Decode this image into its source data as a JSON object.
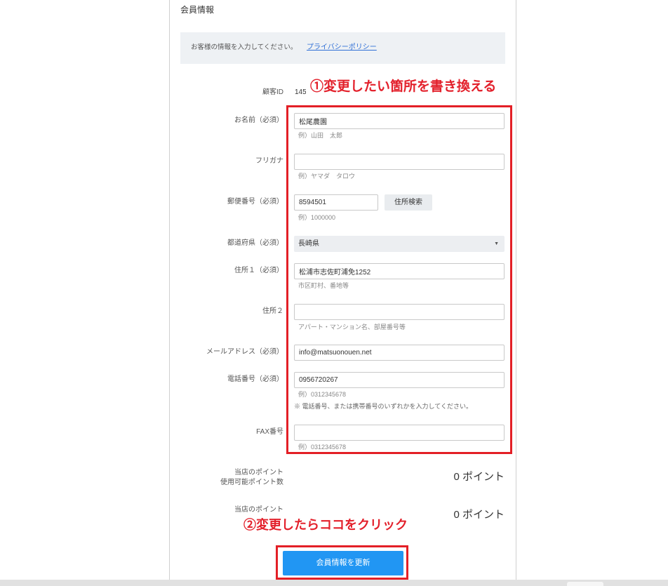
{
  "header": {
    "title": "会員情報"
  },
  "notice": {
    "text": "お客様の情報を入力してください。",
    "link_label": "プライバシーポリシー"
  },
  "customer_id": {
    "label": "顧客ID",
    "value": "145"
  },
  "form": {
    "name": {
      "label": "お名前（必須）",
      "value": "松尾農園",
      "hint": "例）山田　太郎"
    },
    "furigana": {
      "label": "フリガナ",
      "value": "",
      "hint": "例）ヤマダ　タロウ"
    },
    "postal_code": {
      "label": "郵便番号（必須）",
      "value": "8594501",
      "hint": "例）1000000",
      "search_button": "住所検索"
    },
    "prefecture": {
      "label": "都道府県（必須）",
      "selected": "長崎県"
    },
    "address1": {
      "label": "住所１（必須）",
      "value": "松浦市志佐町浦免1252",
      "hint": "市区町村、番地等"
    },
    "address2": {
      "label": "住所２",
      "value": "",
      "hint": "アパート・マンション名、部屋番号等"
    },
    "email": {
      "label": "メールアドレス（必須）",
      "value": "info@matsuonouen.net"
    },
    "phone": {
      "label": "電話番号（必須）",
      "value": "0956720267",
      "hint": "例）0312345678",
      "note": "※ 電話番号、または携帯番号のいずれかを入力してください。"
    },
    "fax": {
      "label": "FAX番号",
      "value": "",
      "hint": "例）0312345678"
    }
  },
  "points": [
    {
      "label_line1": "当店のポイント",
      "label_line2": "使用可能ポイント数",
      "value": "0 ポイント"
    },
    {
      "label_line1": "当店のポイント",
      "value": "0 ポイント"
    }
  ],
  "annotations": {
    "step1": "①変更したい箇所を書き換える",
    "step2": "②変更したらココをクリック"
  },
  "submit_button": "会員情報を更新",
  "icons": {
    "prefecture_select": "chevron-down-icon"
  },
  "colors": {
    "annotation_red": "#e3202b",
    "button_blue": "#2196f3",
    "link_blue": "#2f6fd6",
    "notice_background": "#eef1f4"
  }
}
